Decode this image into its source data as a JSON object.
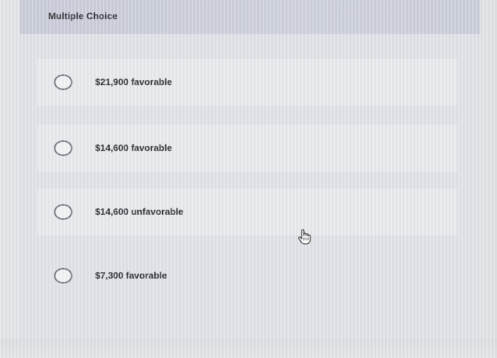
{
  "header": {
    "title": "Multiple Choice"
  },
  "options": [
    {
      "label": "$21,900 favorable"
    },
    {
      "label": "$14,600 favorable"
    },
    {
      "label": "$14,600 unfavorable"
    },
    {
      "label": "$7,300 favorable"
    }
  ],
  "cursor": {
    "icon": "hand-pointer-icon"
  }
}
